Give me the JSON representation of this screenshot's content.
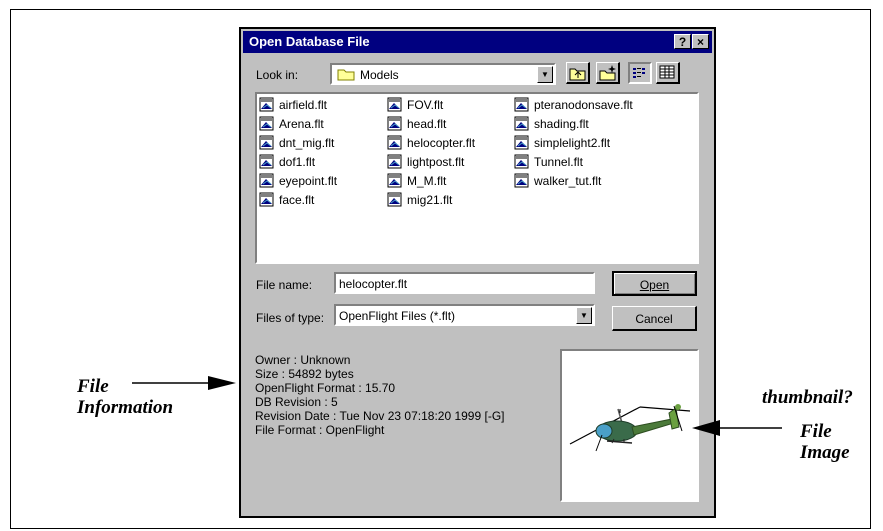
{
  "dialog": {
    "title": "Open Database File",
    "help_btn": "?",
    "close_btn": "×",
    "look_in_label": "Look in:",
    "look_in_value": "Models",
    "files_col1": [
      "airfield.flt",
      "Arena.flt",
      "dnt_mig.flt",
      "dof1.flt",
      "eyepoint.flt",
      "face.flt"
    ],
    "files_col2": [
      "FOV.flt",
      "head.flt",
      "helocopter.flt",
      "lightpost.flt",
      "M_M.flt",
      "mig21.flt"
    ],
    "files_col3": [
      "pteranodonsave.flt",
      "shading.flt",
      "simplelight2.flt",
      "Tunnel.flt",
      "walker_tut.flt"
    ],
    "file_name_label": "File name:",
    "file_name_value": "helocopter.flt",
    "files_of_type_label": "Files of type:",
    "files_of_type_value": "OpenFlight Files (*.flt)",
    "open_label": "Open",
    "cancel_label": "Cancel",
    "info_lines": [
      "Owner : Unknown",
      "Size : 54892 bytes",
      "OpenFlight Format : 15.70",
      "DB Revision : 5",
      "Revision Date : Tue Nov 23 07:18:20 1999 [-G]",
      "File Format : OpenFlight"
    ]
  },
  "annotations": {
    "file_info_line1": "File",
    "file_info_line2": "Information",
    "thumbnail": "thumbnail?",
    "file_image_line1": "File",
    "file_image_line2": "Image"
  }
}
